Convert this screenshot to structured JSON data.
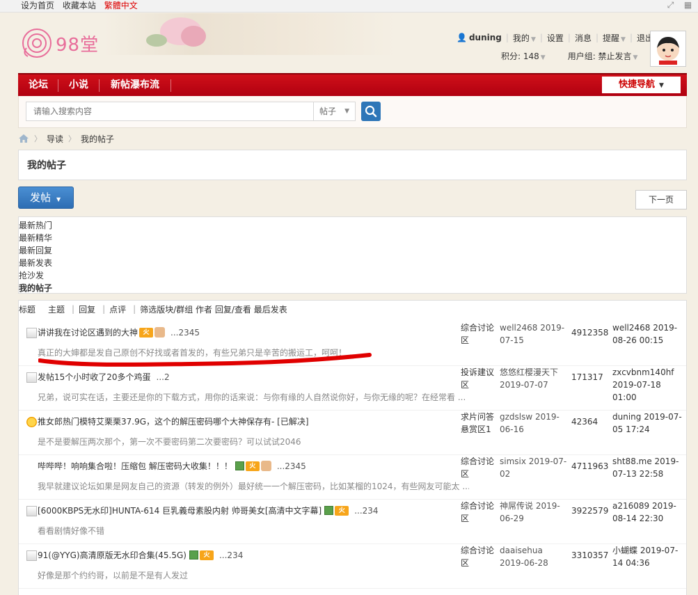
{
  "topbar": {
    "links": [
      "设为首页",
      "收藏本站",
      "繁體中文"
    ]
  },
  "logo": {
    "text": "98堂"
  },
  "user": {
    "name": "duning",
    "menu": [
      "我的",
      "设置",
      "消息",
      "提醒",
      "退出"
    ],
    "points_label": "积分: 148",
    "group_label": "用户组: 禁止发言"
  },
  "nav": {
    "items": [
      "论坛",
      "小说",
      "新帖瀑布流"
    ],
    "quick_nav": "快捷导航"
  },
  "search": {
    "placeholder": "请输入搜索内容",
    "type": "帖子"
  },
  "breadcrumb": [
    "导读",
    "我的帖子"
  ],
  "page_title": "我的帖子",
  "post_button": "发帖",
  "next_button": "下一页",
  "filters": [
    "最新热门",
    "最新精华",
    "最新回复",
    "最新发表",
    "抢沙发",
    "我的帖子"
  ],
  "list_header": {
    "cols": [
      "标题",
      "主题",
      "回复",
      "点评",
      "筛选版块/群组 作者 回复/查看 最后发表"
    ]
  },
  "threads": [
    {
      "title": "讲讲我在讨论区遇到的大神",
      "pages": "...2345",
      "summary": "真正的大婶都是发自己原创不好找或者首发的，有些兄弟只是辛苦的搬运工，呵呵！ ...",
      "forum": "综合讨论区",
      "author": "well2468 2019-07-15",
      "stats": "4912358",
      "last": "well2468 2019-08-26 00:15"
    },
    {
      "title": "发帖15个小时收了20多个鸡蛋",
      "pages": "...2",
      "summary": "兄弟，说可实在话，主要还是你的下载方式，用你的话来说：与你有缘的人自然说你好，与你无缘的呢？在经常看 ...",
      "forum": "投诉建议区",
      "author": "悠悠红樱漫天下 2019-07-07",
      "stats": "171317",
      "last": "zxcvbnm140hf 2019-07-18 01:00"
    },
    {
      "title": "推女郎热门模特艾栗栗37.9G，这个的解压密码哪个大神保存有- [已解决]",
      "pages": "",
      "summary": "是不是要解压两次那个，第一次不要密码第二次要密码？可以试试2046",
      "forum": "求片问答悬赏区1",
      "author": "gzdslsw 2019-06-16",
      "stats": "42364",
      "last": "duning 2019-07-05 17:24"
    },
    {
      "title": "哔哔哔！响响集合啦！压缩包 解压密码大收集！！！",
      "pages": "...2345",
      "summary": "我早就建议论坛如果是网友自己的资源（转发的例外）最好统一一个解压密码，比如某榴的1024，有些网友可能太 ...",
      "forum": "综合讨论区",
      "author": "simsix 2019-07-02",
      "stats": "4711963",
      "last": "sht88.me 2019-07-13 22:58"
    },
    {
      "title": "[6000KBPS无水印]HUNTA-614 巨乳義母素股内射 帅哥美女[高清中文字幕]",
      "pages": "...234",
      "summary": "看看剧情好像不错",
      "forum": "综合讨论区",
      "author": "神屌传说 2019-06-29",
      "stats": "3922579",
      "last": "a216089 2019-08-14 22:30"
    },
    {
      "title": "91(@YYG)高清原版无水印合集(45.5G)",
      "pages": "...234",
      "summary": "好像是那个约约哥，以前是不是有人发过",
      "forum": "综合讨论区",
      "author": "daaisehua 2019-06-28",
      "stats": "3310357",
      "last": "小蝴蝶 2019-07-14 04:36"
    }
  ],
  "colors": {
    "nav_red": "#c20a15",
    "accent_blue": "#2e76b8",
    "annotation_red": "#e00000"
  }
}
